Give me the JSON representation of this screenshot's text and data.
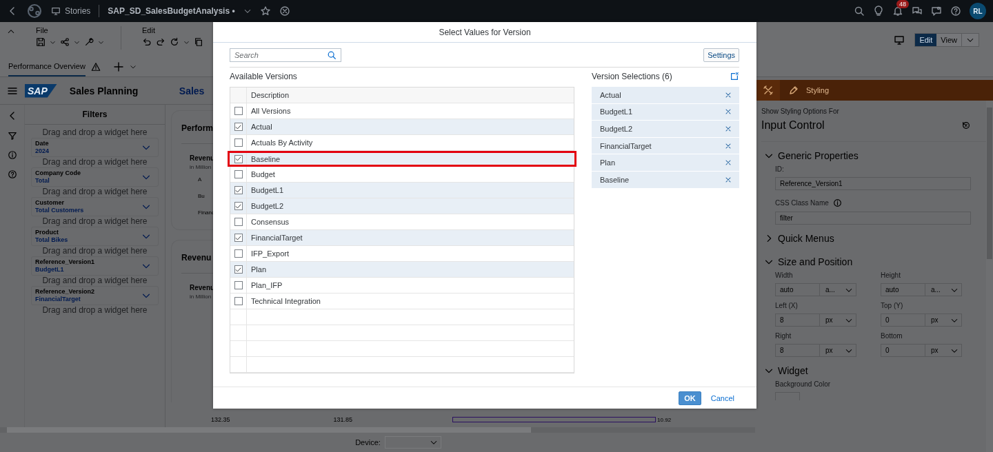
{
  "shell_bar": {
    "breadcrumb": "Stories",
    "story_title": "SAP_SD_SalesBudgetAnalysis",
    "unsaved_marker": "•",
    "notification_count": "48",
    "avatar": "RL"
  },
  "toolbar": {
    "groups": [
      "File",
      "Edit"
    ],
    "modes": [
      {
        "label": "Edit",
        "selected": true
      },
      {
        "label": "View",
        "selected": false
      }
    ]
  },
  "page_tabs": [
    {
      "label": "Performance Overview",
      "selected": true,
      "warning": true
    }
  ],
  "app_header": {
    "logo": "SAP",
    "title": "Sales Planning",
    "page_title": "Sales"
  },
  "filters": {
    "title": "Filters",
    "items": [
      {
        "hint": "Drag and drop a widget here",
        "label": "Date",
        "value": "2024"
      },
      {
        "hint": "Drag and drop a widget here",
        "label": "Company Code",
        "value": "Total"
      },
      {
        "hint": "Drag and drop a widget here",
        "label": "Customer",
        "value": "Total Customers"
      },
      {
        "hint": "Drag and drop a widget here",
        "label": "Product",
        "value": "Total Bikes"
      },
      {
        "hint": "Drag and drop a widget here",
        "label": "Reference_Version1",
        "value": "BudgetL1"
      },
      {
        "hint": "Drag and drop a widget here",
        "label": "Reference_Version2",
        "value": "FinancialTarget"
      }
    ],
    "last_hint": "Drag and drop a widget here"
  },
  "main": {
    "card_1": {
      "title": "Perform",
      "subtitle": "Revenu",
      "unit": "in Million",
      "rows": [
        "A",
        "Bu",
        "Financ"
      ]
    },
    "card_2": {
      "title": "Revenu",
      "subtitle": "Revenu",
      "unit": "in Million"
    },
    "chart_labels": [
      "132.35",
      "131.85"
    ],
    "bar_value": "10.92"
  },
  "device": {
    "label": "Device:"
  },
  "styling_panel": {
    "tab": "Styling",
    "caption": "Show Styling Options For",
    "title": "Input Control",
    "sections": [
      {
        "title": "Generic Properties",
        "expanded": true,
        "kind": "generic"
      },
      {
        "title": "Quick Menus",
        "expanded": false
      },
      {
        "title": "Size and Position",
        "expanded": true,
        "kind": "size"
      },
      {
        "title": "Widget",
        "expanded": true,
        "kind": "widget"
      }
    ],
    "id_label": "ID:",
    "id_value": "Reference_Version1",
    "css_label": "CSS Class Name",
    "css_value": "filter",
    "size_fields": [
      {
        "label": "Width",
        "value": "auto",
        "unit": "a..."
      },
      {
        "label": "Height",
        "value": "auto",
        "unit": "a..."
      },
      {
        "label": "Left (X)",
        "value": "8",
        "unit": "px"
      },
      {
        "label": "Top (Y)",
        "value": "0",
        "unit": "px"
      },
      {
        "label": "Right",
        "value": "8",
        "unit": "px"
      },
      {
        "label": "Bottom",
        "value": "0",
        "unit": "px"
      }
    ],
    "widget_label": "Background Color"
  },
  "dialog": {
    "title": "Select Values for Version",
    "search_placeholder": "Search",
    "settings": "Settings",
    "available_title": "Available Versions",
    "column": "Description",
    "versions": [
      {
        "label": "All Versions",
        "checked": false,
        "highlighted": false
      },
      {
        "label": "Actual",
        "checked": true,
        "highlighted": false
      },
      {
        "label": "Actuals By Activity",
        "checked": false,
        "highlighted": false
      },
      {
        "label": "Baseline",
        "checked": true,
        "highlighted": true
      },
      {
        "label": "Budget",
        "checked": false,
        "highlighted": false
      },
      {
        "label": "BudgetL1",
        "checked": true,
        "highlighted": false
      },
      {
        "label": "BudgetL2",
        "checked": true,
        "highlighted": false
      },
      {
        "label": "Consensus",
        "checked": false,
        "highlighted": false
      },
      {
        "label": "FinancialTarget",
        "checked": true,
        "highlighted": false
      },
      {
        "label": "IFP_Export",
        "checked": false,
        "highlighted": false
      },
      {
        "label": "Plan",
        "checked": true,
        "highlighted": false
      },
      {
        "label": "Plan_IFP",
        "checked": false,
        "highlighted": false
      },
      {
        "label": "Technical Integration",
        "checked": false,
        "highlighted": false
      }
    ],
    "selections_title": "Version Selections (6)",
    "selections": [
      "Actual",
      "BudgetL1",
      "BudgetL2",
      "FinancialTarget",
      "Plan",
      "Baseline"
    ],
    "ok": "OK",
    "cancel": "Cancel"
  }
}
